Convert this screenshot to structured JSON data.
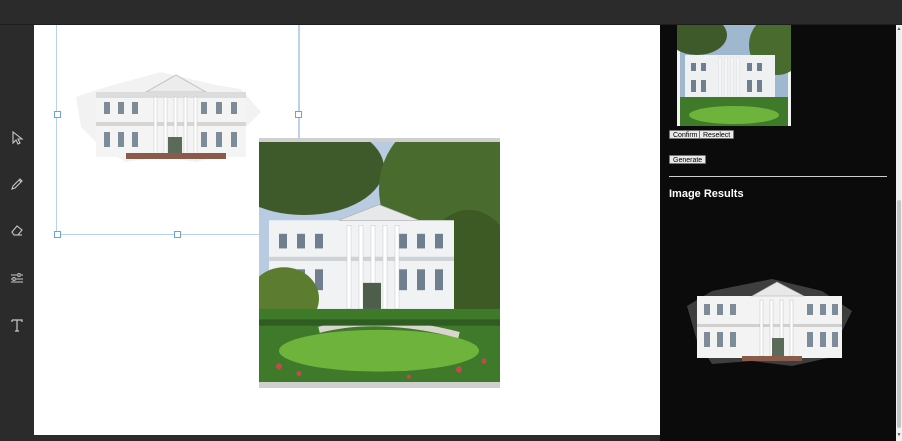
{
  "toolbar": {
    "tools": [
      {
        "name": "select",
        "icon": "pointer-icon"
      },
      {
        "name": "brush",
        "icon": "pencil-icon"
      },
      {
        "name": "eraser",
        "icon": "eraser-icon"
      },
      {
        "name": "adjust",
        "icon": "sliders-icon"
      },
      {
        "name": "text",
        "icon": "text-icon"
      }
    ]
  },
  "panel": {
    "confirm_label": "Confirm",
    "reselect_label": "Reselect",
    "generate_label": "Generate",
    "results_title": "Image Results"
  },
  "colors": {
    "chrome": "#2b2b2b",
    "panel_bg": "#0b0b0b",
    "canvas_bg": "#ffffff",
    "selection": "#b9d2ee"
  }
}
